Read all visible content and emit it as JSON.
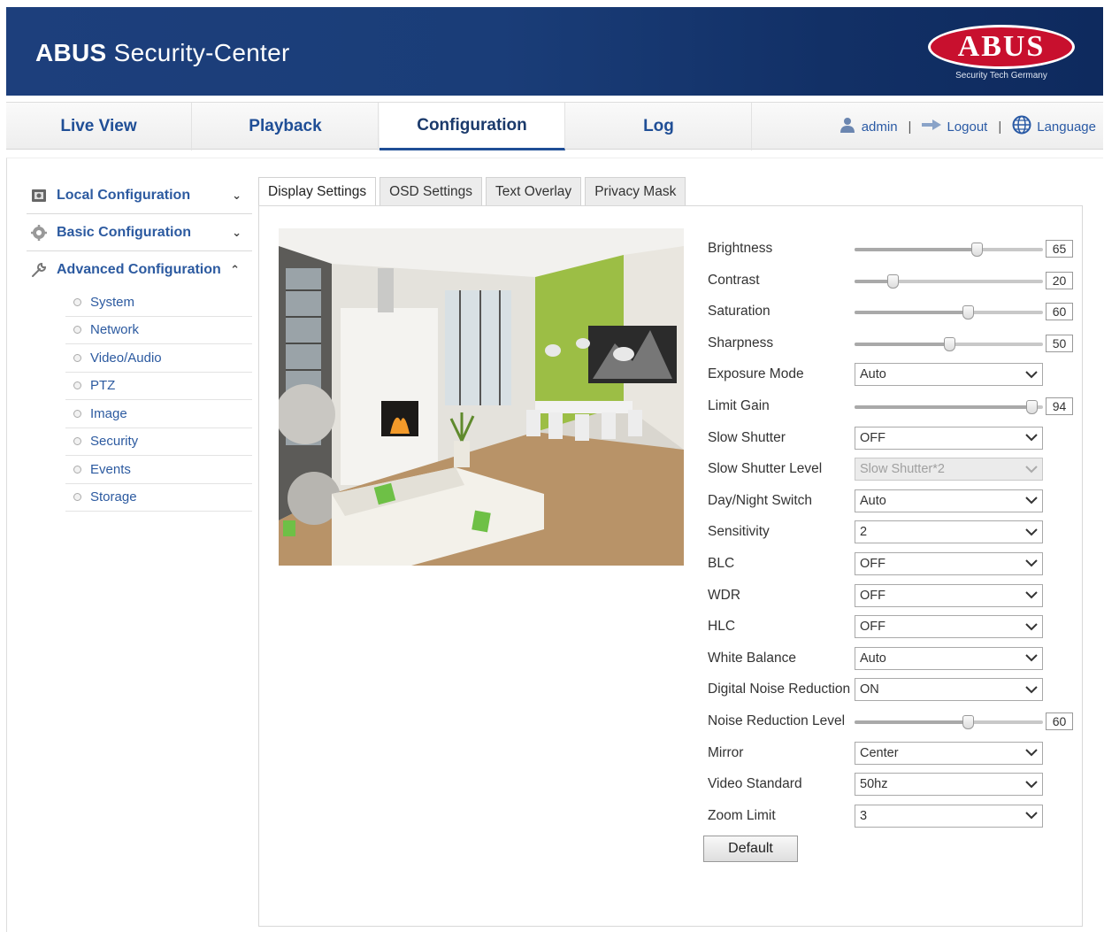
{
  "header": {
    "app_title_bold": "ABUS",
    "app_title_rest": " Security-Center",
    "logo_text": "ABUS",
    "logo_tagline": "Security Tech Germany"
  },
  "nav": {
    "tabs": [
      {
        "label": "Live View"
      },
      {
        "label": "Playback"
      },
      {
        "label": "Configuration",
        "active": true
      },
      {
        "label": "Log"
      }
    ],
    "user": "admin",
    "logout": "Logout",
    "language": "Language",
    "separator": "|"
  },
  "sidebar": {
    "local": "Local Configuration",
    "basic": "Basic Configuration",
    "advanced": "Advanced Configuration",
    "items": [
      "System",
      "Network",
      "Video/Audio",
      "PTZ",
      "Image",
      "Security",
      "Events",
      "Storage"
    ]
  },
  "subtabs": [
    "Display Settings",
    "OSD Settings",
    "Text Overlay",
    "Privacy Mask"
  ],
  "settings": {
    "brightness": {
      "label": "Brightness",
      "value": "65"
    },
    "contrast": {
      "label": "Contrast",
      "value": "20"
    },
    "saturation": {
      "label": "Saturation",
      "value": "60"
    },
    "sharpness": {
      "label": "Sharpness",
      "value": "50"
    },
    "exposure_mode": {
      "label": "Exposure Mode",
      "value": "Auto"
    },
    "limit_gain": {
      "label": "Limit Gain",
      "value": "94"
    },
    "slow_shutter": {
      "label": "Slow Shutter",
      "value": "OFF"
    },
    "slow_shutter_level": {
      "label": "Slow Shutter Level",
      "value": "Slow Shutter*2"
    },
    "day_night": {
      "label": "Day/Night Switch",
      "value": "Auto"
    },
    "sensitivity": {
      "label": "Sensitivity",
      "value": "2"
    },
    "blc": {
      "label": "BLC",
      "value": "OFF"
    },
    "wdr": {
      "label": "WDR",
      "value": "OFF"
    },
    "hlc": {
      "label": "HLC",
      "value": "OFF"
    },
    "white_balance": {
      "label": "White Balance",
      "value": "Auto"
    },
    "dnr": {
      "label": "Digital Noise Reduction",
      "value": "ON"
    },
    "nr_level": {
      "label": "Noise Reduction Level",
      "value": "60"
    },
    "mirror": {
      "label": "Mirror",
      "value": "Center"
    },
    "video_standard": {
      "label": "Video Standard",
      "value": "50hz"
    },
    "zoom_limit": {
      "label": "Zoom Limit",
      "value": "3"
    },
    "default_button": "Default"
  }
}
